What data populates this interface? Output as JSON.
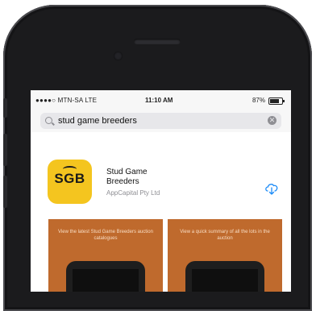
{
  "status_bar": {
    "carrier": "●●●●○ MTN-SA  LTE",
    "time": "11:10 AM",
    "battery": "87%"
  },
  "search": {
    "query": "stud game breeders"
  },
  "app": {
    "icon_text": "SGB",
    "name": "Stud Game Breeders",
    "developer": "AppCapital Pty Ltd",
    "icon_color": "#f4c51f"
  },
  "screenshots": [
    {
      "caption": "View the latest Stud Game Breeders auction catalogues"
    },
    {
      "caption": "View a quick summary of all the lots in the auction"
    }
  ],
  "colors": {
    "accent": "#1d8cf8",
    "screenshot_bg": "#bf6a2d",
    "phone": "#1b1b1d"
  }
}
